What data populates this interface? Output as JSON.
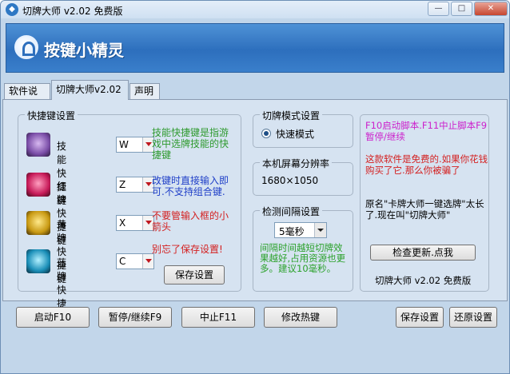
{
  "window": {
    "title": "切牌大师 v2.02 免费版",
    "min_glyph": "—",
    "max_glyph": "□",
    "close_glyph": "✕"
  },
  "banner": {
    "brand_text": "按键小精灵"
  },
  "tabs": [
    {
      "label": "软件说明",
      "active": false
    },
    {
      "label": "切牌大师v2.02",
      "active": true
    },
    {
      "label": "声明",
      "active": false
    }
  ],
  "hotkeys": {
    "group_title": "快捷键设置",
    "rows": [
      {
        "label": "技能快捷键",
        "value": "W",
        "icon": "purple-card-icon"
      },
      {
        "label": "红牌快捷键",
        "value": "Z",
        "icon": "red-card-icon"
      },
      {
        "label": "黄牌快捷键",
        "value": "X",
        "icon": "yellow-card-icon"
      },
      {
        "label": "蓝牌快捷键",
        "value": "C",
        "icon": "blue-card-icon"
      }
    ],
    "notes": [
      {
        "text": "技能快捷键是指游戏中选牌技能的快捷键",
        "color": "#2e9a2e"
      },
      {
        "text": "改键时直接输入即可.不支持组合键.",
        "color": "#1f3fc8"
      },
      {
        "text": "不要管输入框的小箭头",
        "color": "#d42020"
      },
      {
        "text": "别忘了保存设置!",
        "color": "#d42020"
      }
    ],
    "save_button": "保存设置"
  },
  "mode": {
    "group_title": "切牌模式设置",
    "option_label": "快速模式",
    "selected": true
  },
  "resolution": {
    "group_title": "本机屏幕分辨率",
    "value": "1680×1050"
  },
  "interval": {
    "group_title": "检测间隔设置",
    "value": "5毫秒",
    "note": "间隔时间越短切牌效果越好,占用资源也更多。建议10毫秒。"
  },
  "info": {
    "line1": "F10启动脚本.F11中止脚本F9暂停/继续",
    "line2": "这款软件是免费的.如果你花钱购买了它.那么你被骗了",
    "line3": "原名\"卡牌大师一键选牌\"太长了.现在叫\"切牌大师\"",
    "update_button": "检查更新.点我",
    "version_text": "切牌大师 v2.02 免费版",
    "colors": {
      "line1": "#cc22cc",
      "line2": "#d42020",
      "line3": "#000000"
    }
  },
  "bottom_buttons": {
    "start": "启动F10",
    "pause": "暂停/继续F9",
    "stop": "中止F11",
    "edit_hotkeys": "修改热键",
    "save": "保存设置",
    "restore": "还原设置"
  }
}
